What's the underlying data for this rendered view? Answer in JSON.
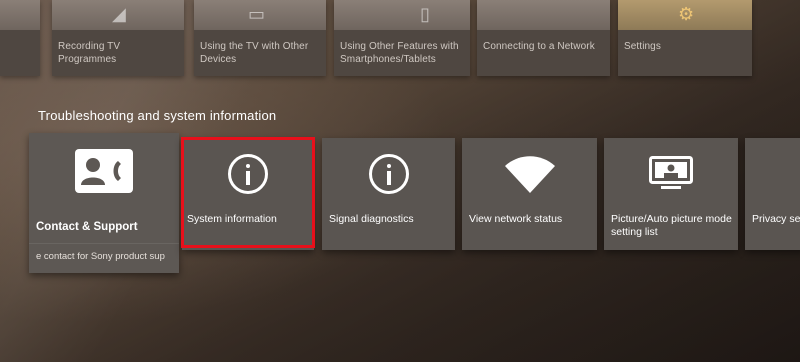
{
  "top_row": {
    "tiles": [
      {
        "label": ""
      },
      {
        "label": "Recording TV Programmes"
      },
      {
        "label": "Using the TV with Other Devices"
      },
      {
        "label": "Using Other Features with Smartphones/Tablets"
      },
      {
        "label": "Connecting to a Network"
      },
      {
        "label": "Settings"
      }
    ]
  },
  "section": {
    "title": "Troubleshooting and system information"
  },
  "tiles": [
    {
      "label": "Contact & Support",
      "sub": "e contact for Sony product sup",
      "icon": "contact-card-icon"
    },
    {
      "label": "System information",
      "icon": "info-icon",
      "highlighted": true
    },
    {
      "label": "Signal diagnostics",
      "icon": "info-icon"
    },
    {
      "label": "View network status",
      "icon": "wifi-icon"
    },
    {
      "label": "Picture/Auto picture mode setting list",
      "icon": "picture-list-icon"
    },
    {
      "label": "Privacy se",
      "icon": ""
    }
  ],
  "colors": {
    "highlight": "#e8101b",
    "tile_bg": "#5a5551",
    "text": "#ffffff"
  }
}
